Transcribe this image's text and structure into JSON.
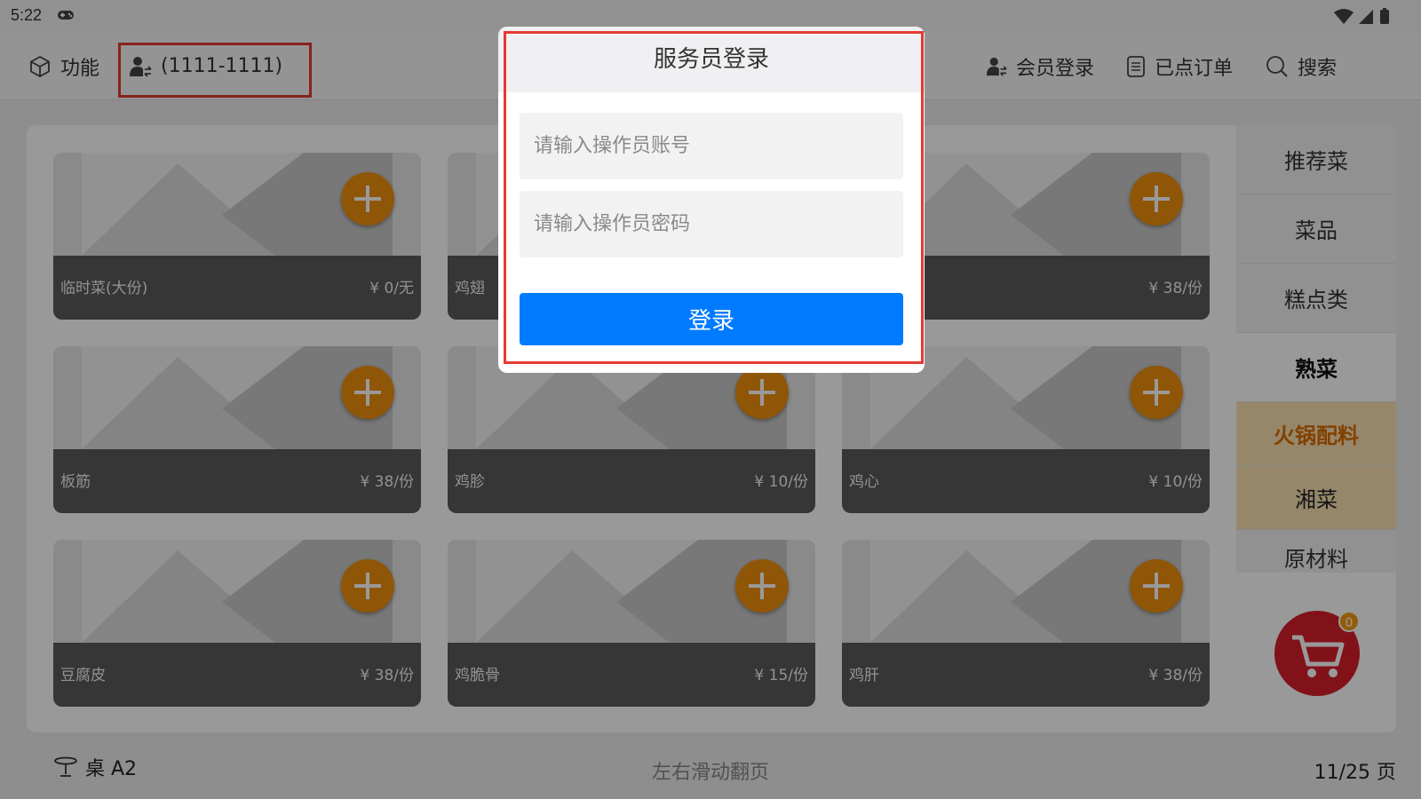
{
  "status": {
    "time": "5:22"
  },
  "topbar": {
    "function_label": "功能",
    "operator_label": "(1111-1111)",
    "member_login_label": "会员登录",
    "orders_label": "已点订单",
    "search_label": "搜索"
  },
  "dishes": [
    {
      "name": "临时菜(大份)",
      "price": "¥ 0/无"
    },
    {
      "name": "鸡翅",
      "price": ""
    },
    {
      "name": "",
      "price": "¥ 38/份"
    },
    {
      "name": "板筋",
      "price": "¥ 38/份"
    },
    {
      "name": "鸡胗",
      "price": "¥ 10/份"
    },
    {
      "name": "鸡心",
      "price": "¥ 10/份"
    },
    {
      "name": "豆腐皮",
      "price": "¥ 38/份"
    },
    {
      "name": "鸡脆骨",
      "price": "¥ 15/份"
    },
    {
      "name": "鸡肝",
      "price": "¥ 38/份"
    }
  ],
  "categories": [
    {
      "label": "推荐菜"
    },
    {
      "label": "菜品"
    },
    {
      "label": "糕点类"
    },
    {
      "label": "熟菜"
    },
    {
      "label": "火锅配料"
    },
    {
      "label": "湘菜"
    },
    {
      "label": "原材料"
    }
  ],
  "cart": {
    "count": "0"
  },
  "bottom": {
    "table_label": "桌 A2",
    "swipe_hint": "左右滑动翻页",
    "page_indicator": "11/25 页"
  },
  "dialog": {
    "title": "服务员登录",
    "account_placeholder": "请输入操作员账号",
    "password_placeholder": "请输入操作员密码",
    "login_label": "登录"
  },
  "colors": {
    "accent_blue": "#007bff",
    "add_orange": "#ef8f0e",
    "cart_red": "#d81e2c",
    "highlight_red": "#e53935"
  }
}
